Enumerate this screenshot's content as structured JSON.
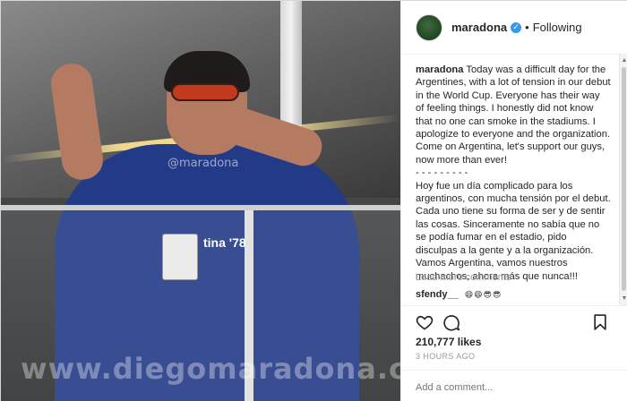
{
  "photo": {
    "shirt_text": "tina '78",
    "tag_watermark": "@maradona",
    "site_watermark": "www.diegomaradona.com"
  },
  "post": {
    "username": "maradona",
    "verified": true,
    "separator": "•",
    "follow_state": "Following",
    "caption_user": "maradona",
    "caption_en": "Today was a difficult day for the Argentines, with a lot of tension in our debut in the World Cup. Everyone has their way of feeling things. I honestly did not know that no one can smoke in the stadiums. I apologize to everyone and the organization. Come on Argentina, let's support our guys, now more than ever!",
    "divider": "- - - - - - - - -",
    "caption_es": "Hoy fue un día complicado para los argentinos, con mucha tensión por el debut. Cada uno tiene su forma de ser y de sentir las cosas. Sinceramente no sabía que no se podía fumar en el estadio, pido disculpas a la gente y a la organización. Vamos Argentina, vamos nuestros muchachos, ahora más que nunca!!!",
    "load_more": "Load more comments",
    "comment_user": "sfendy__",
    "comment_text": "😄😄😎😎",
    "likes": "210,777 likes",
    "time": "3 HOURS AGO",
    "add_comment_placeholder": "Add a comment..."
  },
  "colors": {
    "accent_blue": "#3897f0",
    "muted": "#999999",
    "text": "#262626"
  },
  "icons": [
    "heart-icon",
    "comment-icon",
    "bookmark-icon",
    "verified-badge-icon"
  ]
}
